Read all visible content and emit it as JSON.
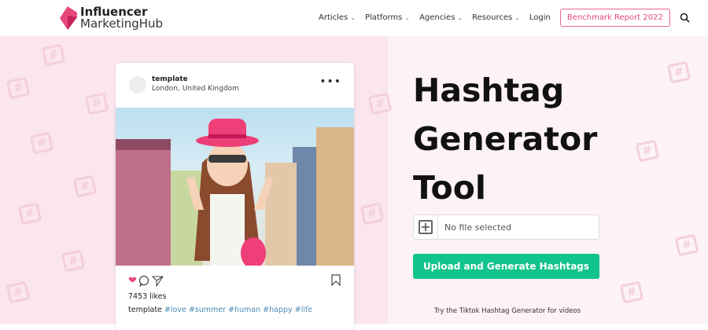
{
  "header": {
    "logo_line1": "Influencer",
    "logo_line2": "MarketingHub",
    "nav": [
      "Articles",
      "Platforms",
      "Agencies",
      "Resources"
    ],
    "login": "Login",
    "benchmark": "Benchmark Report 2022"
  },
  "post": {
    "username": "template",
    "location": "London, United Kingdom",
    "likes": "7453 likes",
    "caption_user": "template",
    "hashtags": "#love #summer #human #happy #life"
  },
  "hero": {
    "title_lines": [
      "Hashtag",
      "Generator",
      "Tool"
    ],
    "file_status": "No file selected",
    "upload_label": "Upload and Generate Hashtags",
    "tiktok_link": "Try the Tiktok Hashtag Generator for videos"
  },
  "colors": {
    "brand": "#e8477a",
    "accent": "#11c48b",
    "hashtag": "#4a8bb5"
  }
}
